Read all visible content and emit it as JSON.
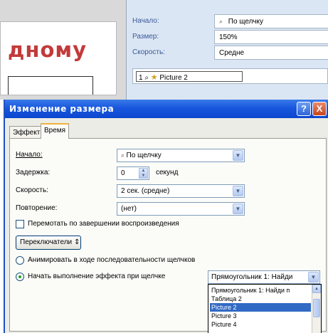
{
  "slide": {
    "text": "дному"
  },
  "pane": {
    "start_label": "Начало:",
    "start_value": "По щелчку",
    "size_label": "Размер:",
    "size_value": "150%",
    "speed_label": "Скорость:",
    "speed_value": "Средне",
    "list_item_number": "1",
    "list_item_label": "Picture 2"
  },
  "dialog": {
    "title": "Изменение размера",
    "help_label": "?",
    "close_label": "X",
    "tabs": [
      {
        "label": "Эффект"
      },
      {
        "label": "Время"
      }
    ],
    "start": {
      "label": "Начало:",
      "value": "По щелчку"
    },
    "delay": {
      "label": "Задержка:",
      "value": "0",
      "unit": "секунд"
    },
    "speed": {
      "label": "Скорость:",
      "value": "2 сек. (средне)"
    },
    "repeat": {
      "label": "Повторение:",
      "value": "(нет)"
    },
    "rewind": {
      "label": "Перемотать по завершении воспроизведения",
      "checked": false
    },
    "triggers_button": "Переключатели",
    "radio_sequence": {
      "label": "Анимировать в ходе последовательности щелчков",
      "selected": false
    },
    "radio_click": {
      "label": "Начать выполнение эффекта при щелчке",
      "selected": true
    },
    "trigger_value": "Прямоугольник 1: Найди",
    "trigger_options": [
      "Прямоугольник 1: Найди п",
      "Таблица 2",
      "Picture 2",
      "Picture 3",
      "Picture 4"
    ],
    "trigger_selected_index": 2
  },
  "colors": {
    "title_bar": "#1857dd",
    "selection": "#316ac5",
    "slide_text": "#c23a3a"
  },
  "icons": [
    "mouse-click-icon",
    "star-effect-icon",
    "chevron-down-icon",
    "spin-up-icon",
    "spin-down-icon",
    "help-icon",
    "close-icon"
  ]
}
